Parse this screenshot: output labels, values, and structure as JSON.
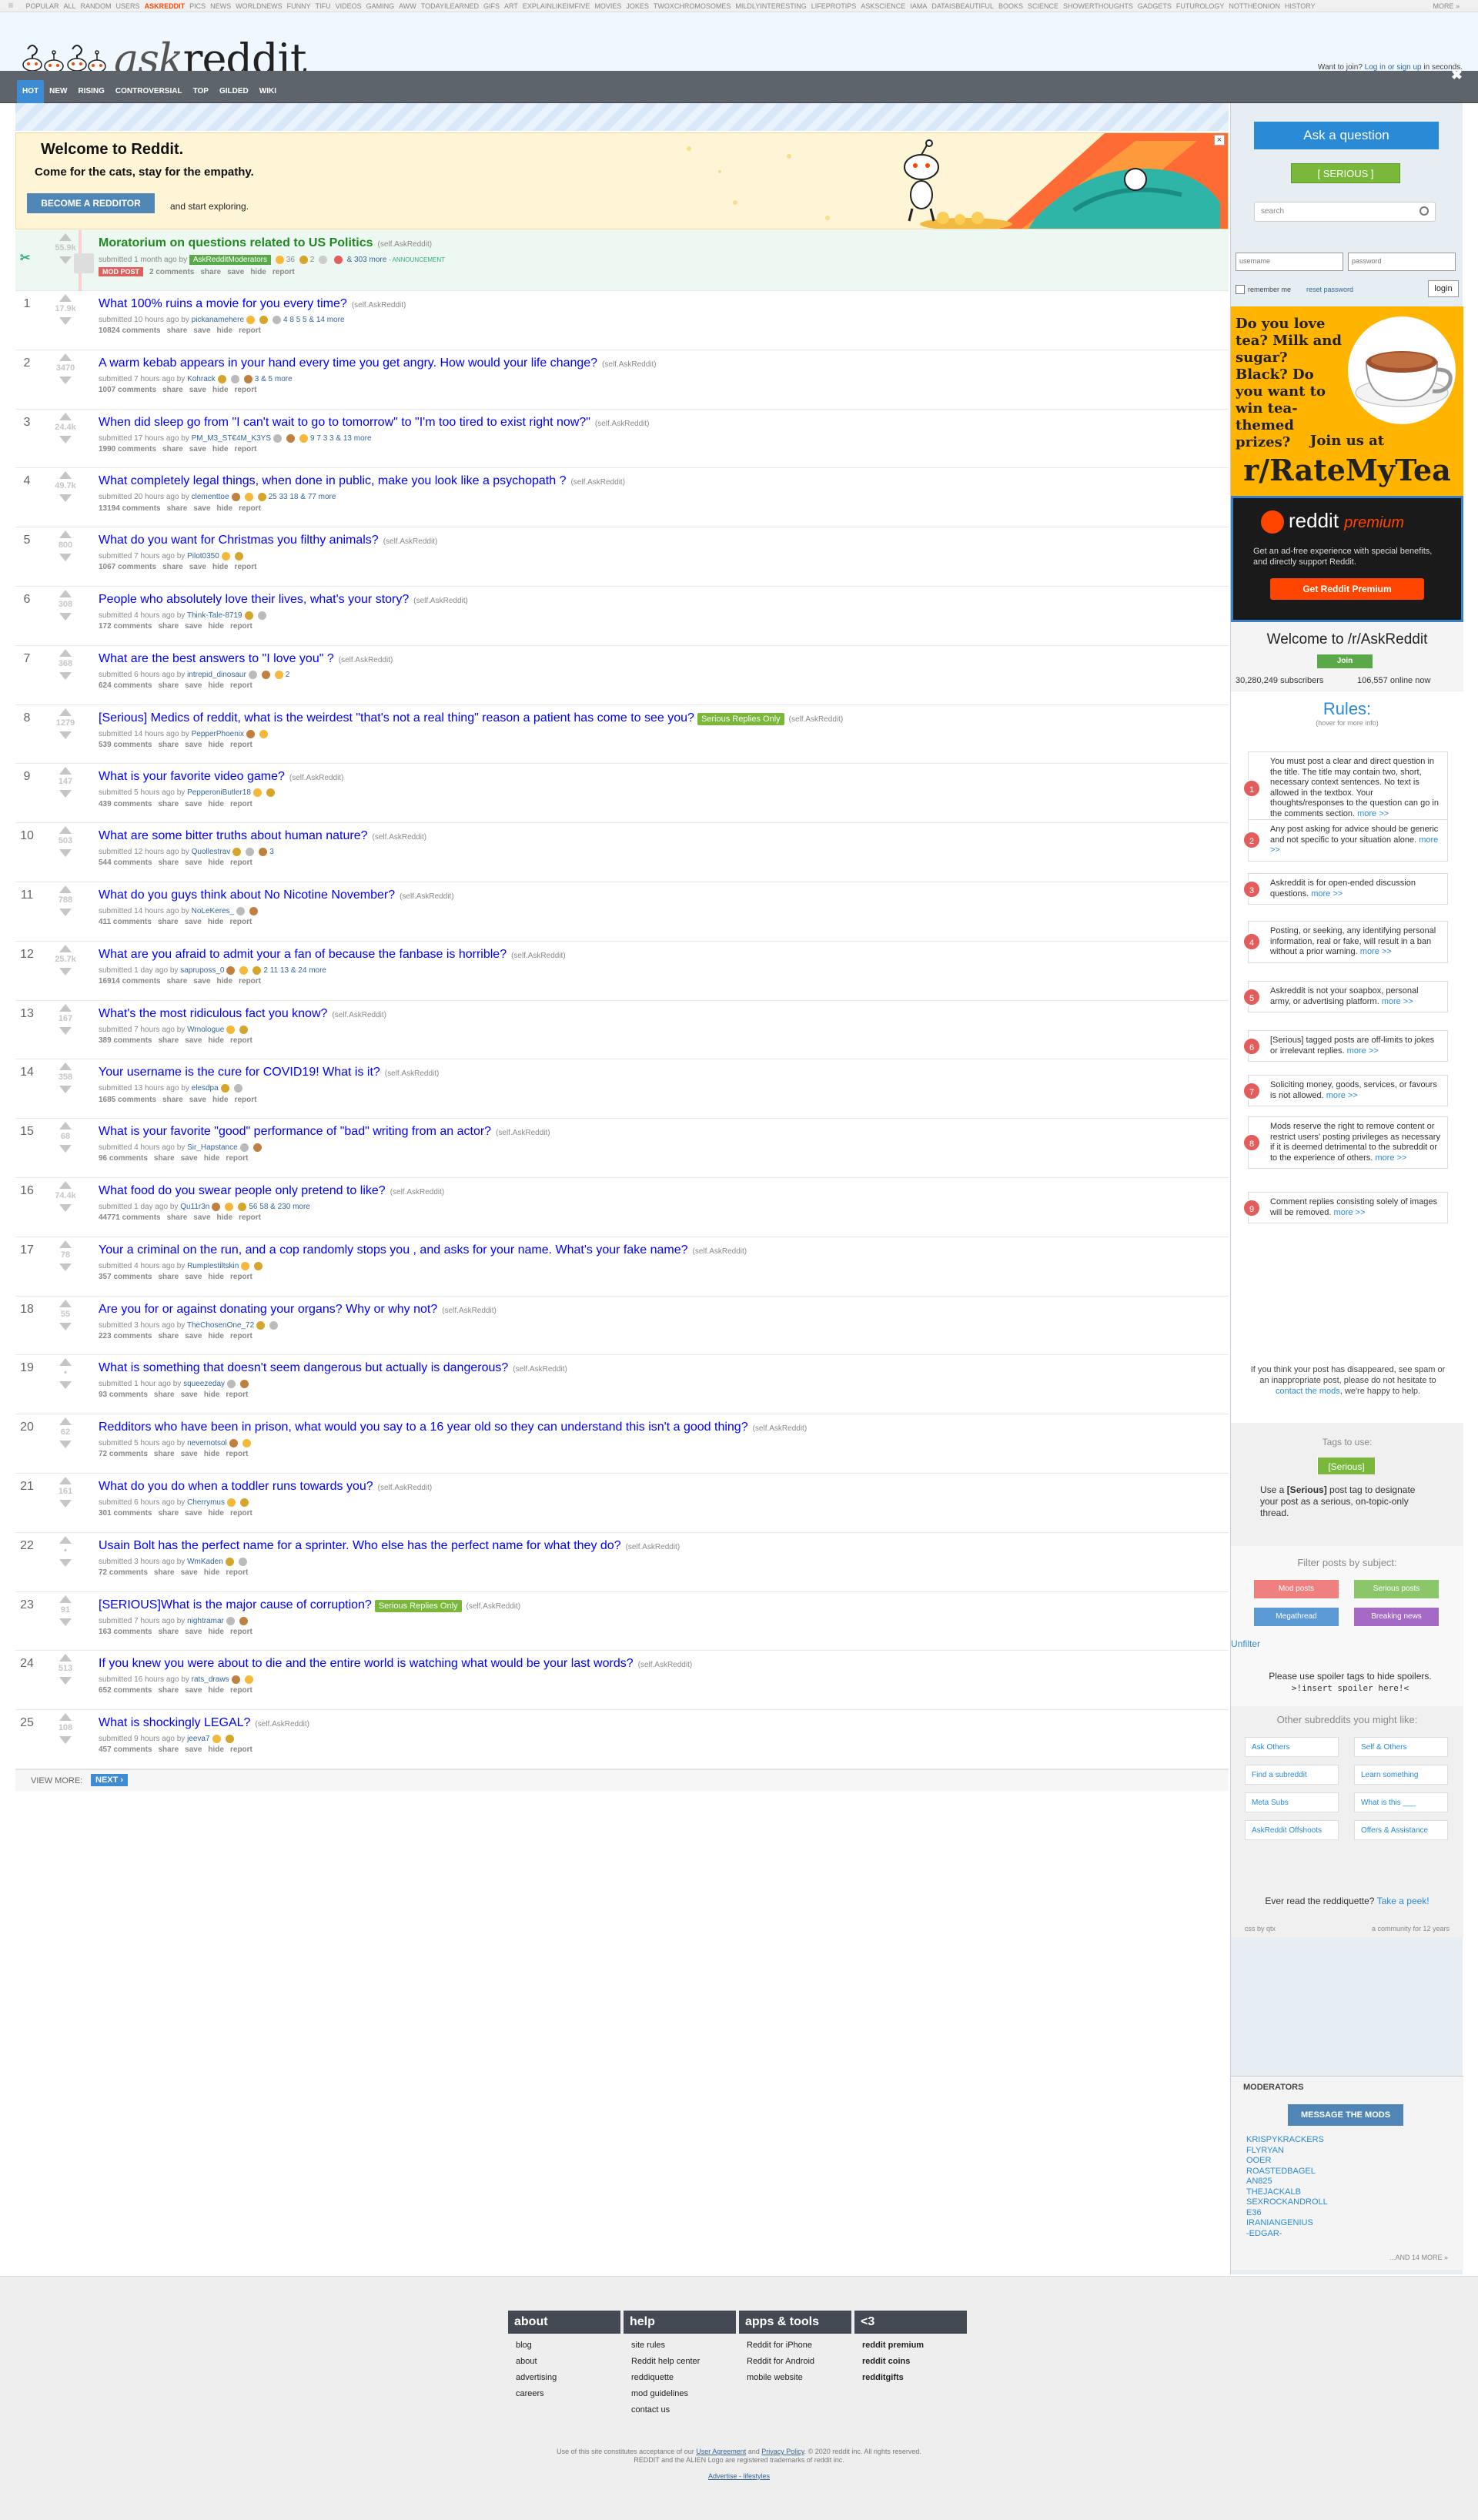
{
  "topbar": {
    "menu_icon": "menu-icon",
    "items": [
      "POPULAR",
      "ALL",
      "RANDOM",
      "USERS",
      "ASKREDDIT",
      "PICS",
      "NEWS",
      "WORLDNEWS",
      "FUNNY",
      "TIFU",
      "VIDEOS",
      "GAMING",
      "AWW",
      "TODAYILEARNED",
      "GIFS",
      "ART",
      "EXPLAINLIKEIMFIVE",
      "MOVIES",
      "JOKES",
      "TWOXCHROMOSOMES",
      "MILDLYINTERESTING",
      "LIFEPROTIPS",
      "ASKSCIENCE",
      "IAMA",
      "DATAISBEAUTIFUL",
      "BOOKS",
      "SCIENCE",
      "SHOWERTHOUGHTS",
      "GADGETS",
      "FUTUROLOGY",
      "NOTTHEONION",
      "HISTORY"
    ],
    "selected": "ASKREDDIT",
    "more": "MORE »"
  },
  "header": {
    "logo_ask": "ask",
    "logo_reddit": "reddit",
    "tabs": [
      "HOT",
      "NEW",
      "RISING",
      "CONTROVERSIAL",
      "TOP",
      "GILDED",
      "WIKI"
    ],
    "selected_tab": "HOT",
    "join_text": "Want to join? ",
    "login_link": "Log in or sign up",
    "join_suffix": " in seconds.",
    "close": "✖"
  },
  "welcome": {
    "title": "Welcome to Reddit.",
    "tagline": "Come for the cats, stay for the empathy.",
    "button": "BECOME A REDDITOR",
    "suffix": "and start exploring.",
    "close": "×"
  },
  "sticky": {
    "title": "Moratorium on questions related to US Politics",
    "domain": "(self.AskReddit)",
    "score": "55.9k",
    "submitted": "submitted 1 month ago by ",
    "author_flair": "AskRedditModerators",
    "awards": "36",
    "awards2": "2",
    "awards_more": "& 303 more",
    "announcement": "- announcement",
    "modpost": "MOD POST",
    "comments": "2 comments",
    "actions": [
      "share",
      "save",
      "hide",
      "report"
    ]
  },
  "posts": [
    {
      "rank": "1",
      "score": "17.9k",
      "title": "What 100% ruins a movie for you every time?",
      "domain": "(self.AskReddit)",
      "time": "10 hours ago",
      "author": "pickanamehere",
      "awards": "4  8  5  5 & 14 more",
      "comments": "10824 comments"
    },
    {
      "rank": "2",
      "score": "3470",
      "title": "A warm kebab appears in your hand every time you get angry. How would your life change?",
      "domain": "(self.AskReddit)",
      "time": "7 hours ago",
      "author": "Kohrack",
      "awards": "3  & 5 more",
      "comments": "1007 comments"
    },
    {
      "rank": "3",
      "score": "24.4k",
      "title": "When did sleep go from \"I can't wait to go to tomorrow\" to \"I'm too tired to exist right now?\"",
      "domain": "(self.AskReddit)",
      "time": "17 hours ago",
      "author": "PM_M3_ST€4M_K3YS",
      "awards": "9  7  3  3 & 13 more",
      "comments": "1990 comments"
    },
    {
      "rank": "4",
      "score": "49.7k",
      "title": "What completely legal things, when done in public, make you look like a psychopath ?",
      "domain": "(self.AskReddit)",
      "time": "20 hours ago",
      "author": "clementtoe",
      "awards": "25  33  18 & 77 more",
      "comments": "13194 comments"
    },
    {
      "rank": "5",
      "score": "800",
      "title": "What do you want for Christmas you filthy animals?",
      "domain": "(self.AskReddit)",
      "time": "7 hours ago",
      "author": "Pilot0350",
      "awards": "",
      "comments": "1067 comments"
    },
    {
      "rank": "6",
      "score": "308",
      "title": "People who absolutely love their lives, what's your story?",
      "domain": "(self.AskReddit)",
      "time": "4 hours ago",
      "author": "Think-Tale-8719",
      "awards": "",
      "comments": "172 comments"
    },
    {
      "rank": "7",
      "score": "368",
      "title": "What are the best answers to \"I love you\" ?",
      "domain": "(self.AskReddit)",
      "time": "6 hours ago",
      "author": "intrepid_dinosaur",
      "awards": "2",
      "comments": "624 comments"
    },
    {
      "rank": "8",
      "score": "1279",
      "title": "[Serious] Medics of reddit, what is the weirdest \"that's not a real thing\" reason a patient has come to see you?",
      "domain": "(self.AskReddit)",
      "flair": "Serious Replies Only",
      "time": "14 hours ago",
      "author": "PepperPhoenix",
      "awards": "",
      "comments": "539 comments"
    },
    {
      "rank": "9",
      "score": "147",
      "title": "What is your favorite video game?",
      "domain": "(self.AskReddit)",
      "time": "5 hours ago",
      "author": "PepperoniButler18",
      "awards": "",
      "comments": "439 comments"
    },
    {
      "rank": "10",
      "score": "503",
      "title": "What are some bitter truths about human nature?",
      "domain": "(self.AskReddit)",
      "time": "12 hours ago",
      "author": "Quollestrav",
      "awards": "3",
      "comments": "544 comments"
    },
    {
      "rank": "11",
      "score": "788",
      "title": "What do you guys think about No Nicotine November?",
      "domain": "(self.AskReddit)",
      "time": "14 hours ago",
      "author": "NoLeKeres_",
      "awards": "",
      "comments": "411 comments"
    },
    {
      "rank": "12",
      "score": "25.7k",
      "title": "What are you afraid to admit your a fan of because the fanbase is horrible?",
      "domain": "(self.AskReddit)",
      "time": "1 day ago",
      "author": "sapruposs_0",
      "awards": "2  11  13 & 24 more",
      "comments": "16914 comments"
    },
    {
      "rank": "13",
      "score": "167",
      "title": "What's the most ridiculous fact you know?",
      "domain": "(self.AskReddit)",
      "time": "7 hours ago",
      "author": "Wrnologue",
      "awards": "",
      "comments": "389 comments"
    },
    {
      "rank": "14",
      "score": "358",
      "title": "Your username is the cure for COVID19! What is it?",
      "domain": "(self.AskReddit)",
      "time": "13 hours ago",
      "author": "elesdpa",
      "awards": "",
      "comments": "1685 comments"
    },
    {
      "rank": "15",
      "score": "68",
      "title": "What is your favorite \"good\" performance of \"bad\" writing from an actor?",
      "domain": "(self.AskReddit)",
      "time": "4 hours ago",
      "author": "Sir_Hapstance",
      "awards": "",
      "comments": "96 comments"
    },
    {
      "rank": "16",
      "score": "74.4k",
      "title": "What food do you swear people only pretend to like?",
      "domain": "(self.AskReddit)",
      "time": "1 day ago",
      "author": "Qu11r3n",
      "awards": "56  58 & 230 more",
      "comments": "44771 comments"
    },
    {
      "rank": "17",
      "score": "78",
      "title": "Your a criminal on the run, and a cop randomly stops you , and asks for your name. What's your fake name?",
      "domain": "(self.AskReddit)",
      "time": "4 hours ago",
      "author": "Rumplestiltskin",
      "awards": "",
      "comments": "357 comments"
    },
    {
      "rank": "18",
      "score": "55",
      "title": "Are you for or against donating your organs? Why or why not?",
      "domain": "(self.AskReddit)",
      "time": "3 hours ago",
      "author": "TheChosenOne_72",
      "awards": "",
      "comments": "223 comments"
    },
    {
      "rank": "19",
      "score": "•",
      "title": "What is something that doesn't seem dangerous but actually is dangerous?",
      "domain": "(self.AskReddit)",
      "time": "1 hour ago",
      "author": "squeezeday",
      "awards": "",
      "comments": "93 comments"
    },
    {
      "rank": "20",
      "score": "62",
      "title": "Redditors who have been in prison, what would you say to a 16 year old so they can understand this isn't a good thing?",
      "domain": "(self.AskReddit)",
      "time": "5 hours ago",
      "author": "nevernotsol",
      "awards": "",
      "comments": "72 comments"
    },
    {
      "rank": "21",
      "score": "161",
      "title": "What do you do when a toddler runs towards you?",
      "domain": "(self.AskReddit)",
      "time": "6 hours ago",
      "author": "Cherrymus",
      "awards": "",
      "comments": "301 comments"
    },
    {
      "rank": "22",
      "score": "•",
      "title": "Usain Bolt has the perfect name for a sprinter. Who else has the perfect name for what they do?",
      "domain": "(self.AskReddit)",
      "time": "3 hours ago",
      "author": "WmKaden",
      "awards": "",
      "comments": "72 comments"
    },
    {
      "rank": "23",
      "score": "91",
      "title": "[SERIOUS]What is the major cause of corruption?",
      "domain": "(self.AskReddit)",
      "flair": "Serious Replies Only",
      "time": "7 hours ago",
      "author": "nightramar",
      "awards": "",
      "comments": "163 comments"
    },
    {
      "rank": "24",
      "score": "513",
      "title": "If you knew you were about to die and the entire world is watching what would be your last words?",
      "domain": "(self.AskReddit)",
      "time": "16 hours ago",
      "author": "rats_draws",
      "awards": "",
      "comments": "652 comments"
    },
    {
      "rank": "25",
      "score": "108",
      "title": "What is shockingly LEGAL?",
      "domain": "(self.AskReddit)",
      "time": "9 hours ago",
      "author": "jeeva7",
      "awards": "",
      "comments": "457 comments"
    }
  ],
  "post_actions": [
    "share",
    "save",
    "hide",
    "report"
  ],
  "submitted_prefix": "submitted ",
  "by": " by ",
  "viewmore": {
    "label": "VIEW MORE:",
    "next": "NEXT ›"
  },
  "sidebar": {
    "ask": "Ask a question",
    "serious": "[ SERIOUS ]",
    "search_placeholder": "search",
    "username_placeholder": "username",
    "password_placeholder": "password",
    "remember": "remember me",
    "reset": "reset password",
    "login": "login",
    "ad_tea_question": "Do you love tea? Milk and sugar? Black? Do you want to win tea-themed prizes?",
    "ad_tea_join": "Join us at",
    "ad_tea_sub": "r/RateMyTea",
    "premium_word1": "reddit",
    "premium_word2": "premium",
    "premium_desc": "Get an ad-free experience with special benefits, and directly support Reddit.",
    "premium_btn": "Get Reddit Premium",
    "welcome_title": "Welcome to /r/AskReddit",
    "join": "Join",
    "subscribers": "30,280,249 subscribers",
    "online": "106,557 online now",
    "rules_title": "Rules:",
    "rules_hover": "(hover for more info)",
    "rules": [
      "You must post a clear and direct question in the title. The title may contain two, short, necessary context sentences. No text is allowed in the textbox. Your thoughts/responses to the question can go in the comments section.",
      "Any post asking for advice should be generic and not specific to your situation alone.",
      "Askreddit is for open-ended discussion questions.",
      "Posting, or seeking, any identifying personal information, real or fake, will result in a ban without a prior warning.",
      "Askreddit is not your soapbox, personal army, or advertising platform.",
      "[Serious] tagged posts are off-limits to jokes or irrelevant replies.",
      "Soliciting money, goods, services, or favours is not allowed.",
      "Mods reserve the right to remove content or restrict users' posting privileges as necessary if it is deemed detrimental to the subreddit or to the experience of others.",
      "Comment replies consisting solely of images will be removed."
    ],
    "more": "more >>",
    "disappeared": "If you think your post has disappeared, see spam or an inappropriate post, please do not hesitate to ",
    "contact": "contact the mods",
    "disappeared2": ", we're happy to help.",
    "tags_title": "Tags to use:",
    "tags_serious": "[Serious]",
    "tags_desc1": "Use a ",
    "tags_desc_b": "[Serious]",
    "tags_desc2": " post tag to designate your post as a serious, on-topic-only thread.",
    "filter_title": "Filter posts by subject:",
    "filters": [
      "Mod posts",
      "Serious posts",
      "Megathread",
      "Breaking news"
    ],
    "unfilter": "Unfilter",
    "spoiler_text": "Please use spoiler tags to hide spoilers.",
    "spoiler_code": ">!insert spoiler here!<",
    "others_title": "Other subreddits you might like:",
    "others": [
      "Ask Others",
      "Self & Others",
      "Find a subreddit",
      "Learn something",
      "Meta Subs",
      "What is this ___",
      "AskReddit Offshoots",
      "Offers & Assistance"
    ],
    "reddiquette": "Ever read the reddiquette? ",
    "peek": "Take a peek!",
    "css": "css by qtx",
    "community": "a community for 12 years",
    "mods_title": "MODERATORS",
    "message_mods": "MESSAGE THE MODS",
    "mods": [
      "KRISPYKRACKERS",
      "FLYRYAN",
      "OOER",
      "ROASTEDBAGEL",
      "AN825",
      "THEJACKALB",
      "SEXROCKANDROLL",
      "E36",
      "IRANIANGENIUS",
      "-EDGAR-"
    ],
    "mods_more": "...AND 14 MORE »"
  },
  "footer": {
    "cols": [
      {
        "h": "about",
        "items": [
          "blog",
          "about",
          "advertising",
          "careers"
        ]
      },
      {
        "h": "help",
        "items": [
          "site rules",
          "Reddit help center",
          "reddiquette",
          "mod guidelines",
          "contact us"
        ]
      },
      {
        "h": "apps & tools",
        "items": [
          "Reddit for iPhone",
          "Reddit for Android",
          "mobile website"
        ]
      },
      {
        "h": "<3",
        "items": [
          "reddit premium",
          "reddit coins",
          "redditgifts"
        ]
      }
    ],
    "legal1": "Use of this site constitutes acceptance of our ",
    "ua": "User Agreement",
    "and": " and ",
    "pp": "Privacy Policy",
    "legal2": ". © 2020 reddit inc. All rights reserved.",
    "legal3": "REDDIT and the ALIEN Logo are registered trademarks of reddit inc.",
    "adv": "Advertise - lifestyles"
  },
  "colors": {
    "link": "#0000ff",
    "accent": "#2a8ad5",
    "serious": "#79b83a",
    "orangered": "#ff4500"
  }
}
